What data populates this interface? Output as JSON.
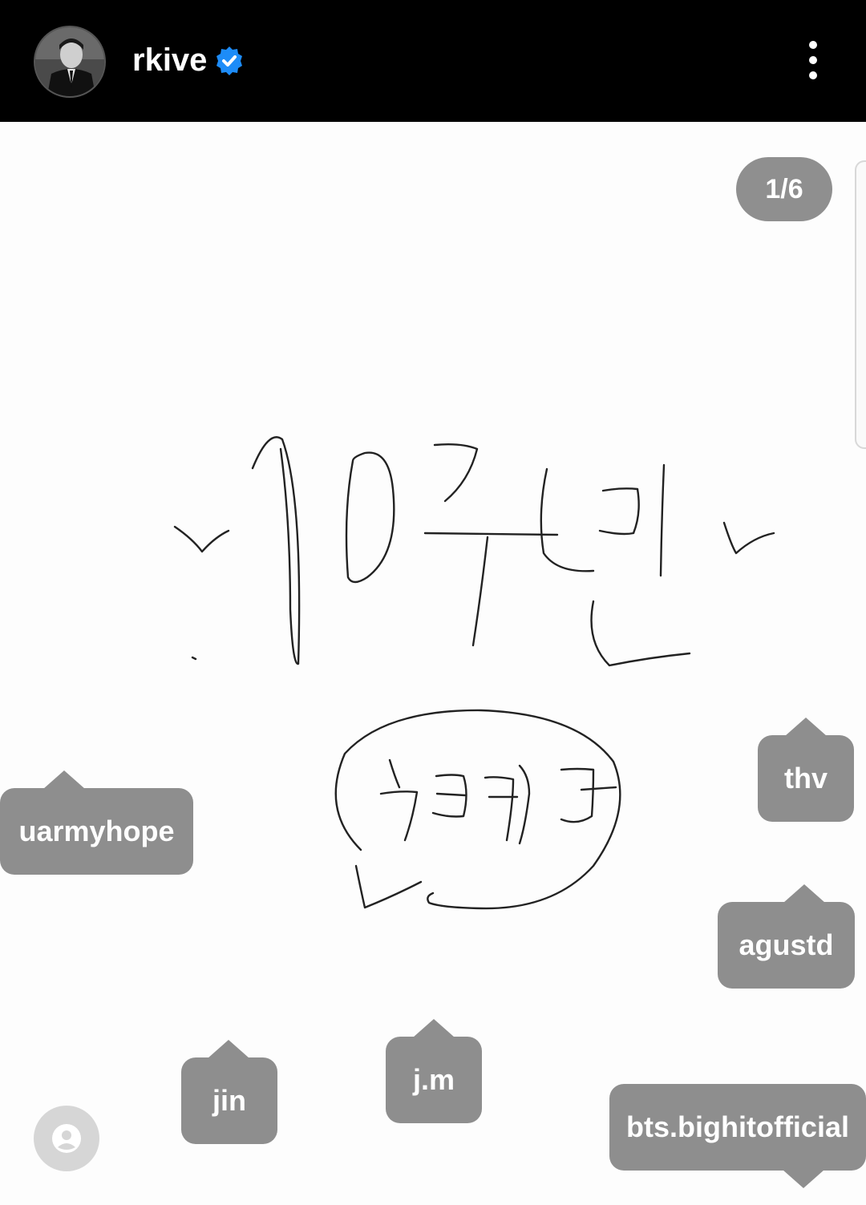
{
  "header": {
    "username": "rkive",
    "verified_icon": "verified-badge-icon",
    "more_icon": "more-vertical-icon"
  },
  "post": {
    "image_counter": "1/6",
    "tags": [
      {
        "label": "uarmyhope"
      },
      {
        "label": "thv"
      },
      {
        "label": "agustd"
      },
      {
        "label": "jin"
      },
      {
        "label": "j.m"
      },
      {
        "label": "bts.bighitofficial"
      }
    ],
    "tagged_users_icon": "person-icon"
  },
  "colors": {
    "header_bg": "#000000",
    "verified_blue": "#1d8cf8",
    "tag_bg": "#8e8e8e"
  }
}
